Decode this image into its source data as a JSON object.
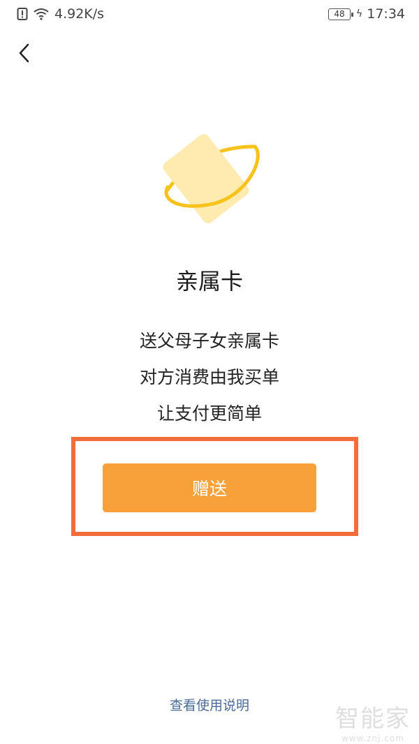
{
  "status_bar": {
    "network_speed": "4.92K/s",
    "battery": "48",
    "time": "17:34"
  },
  "header": {
    "back_icon": "chevron-left-icon"
  },
  "hero": {
    "icon": "card-orbit-icon",
    "card_color": "#FFEBB0",
    "ring_color": "#F7C21C"
  },
  "main": {
    "title": "亲属卡",
    "description": [
      "送父母子女亲属卡",
      "对方消费由我买单",
      "让支付更简单"
    ],
    "gift_button_label": "赠送",
    "accent_color": "#F8A13B",
    "highlight_color": "#F36D3A"
  },
  "footer": {
    "help_link": "查看使用说明"
  },
  "watermark": {
    "main": "智能家",
    "sub": "www.znj.com"
  }
}
